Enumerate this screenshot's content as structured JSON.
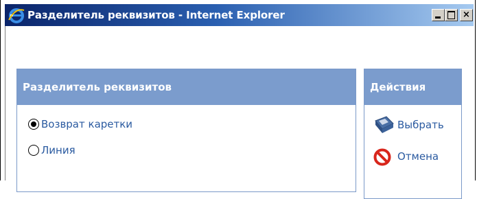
{
  "window": {
    "title": "Разделитель реквизитов - Internet Explorer",
    "app_icon": "ie-logo-icon",
    "controls": {
      "minimize": "minimize-icon",
      "maximize": "maximize-icon",
      "close": "×"
    }
  },
  "separator_panel": {
    "header": "Разделитель реквизитов",
    "options": [
      {
        "label": "Возврат каретки",
        "selected": true
      },
      {
        "label": "Линия",
        "selected": false
      }
    ]
  },
  "actions_panel": {
    "header": "Действия",
    "items": [
      {
        "label": "Выбрать",
        "icon": "floppy-disk-icon"
      },
      {
        "label": "Отмена",
        "icon": "cancel-icon"
      }
    ]
  },
  "colors": {
    "panel_header": "#7b9ccd",
    "link_text": "#2a5aa0",
    "titlebar_start": "#0a246a",
    "titlebar_end": "#a6caf0"
  }
}
